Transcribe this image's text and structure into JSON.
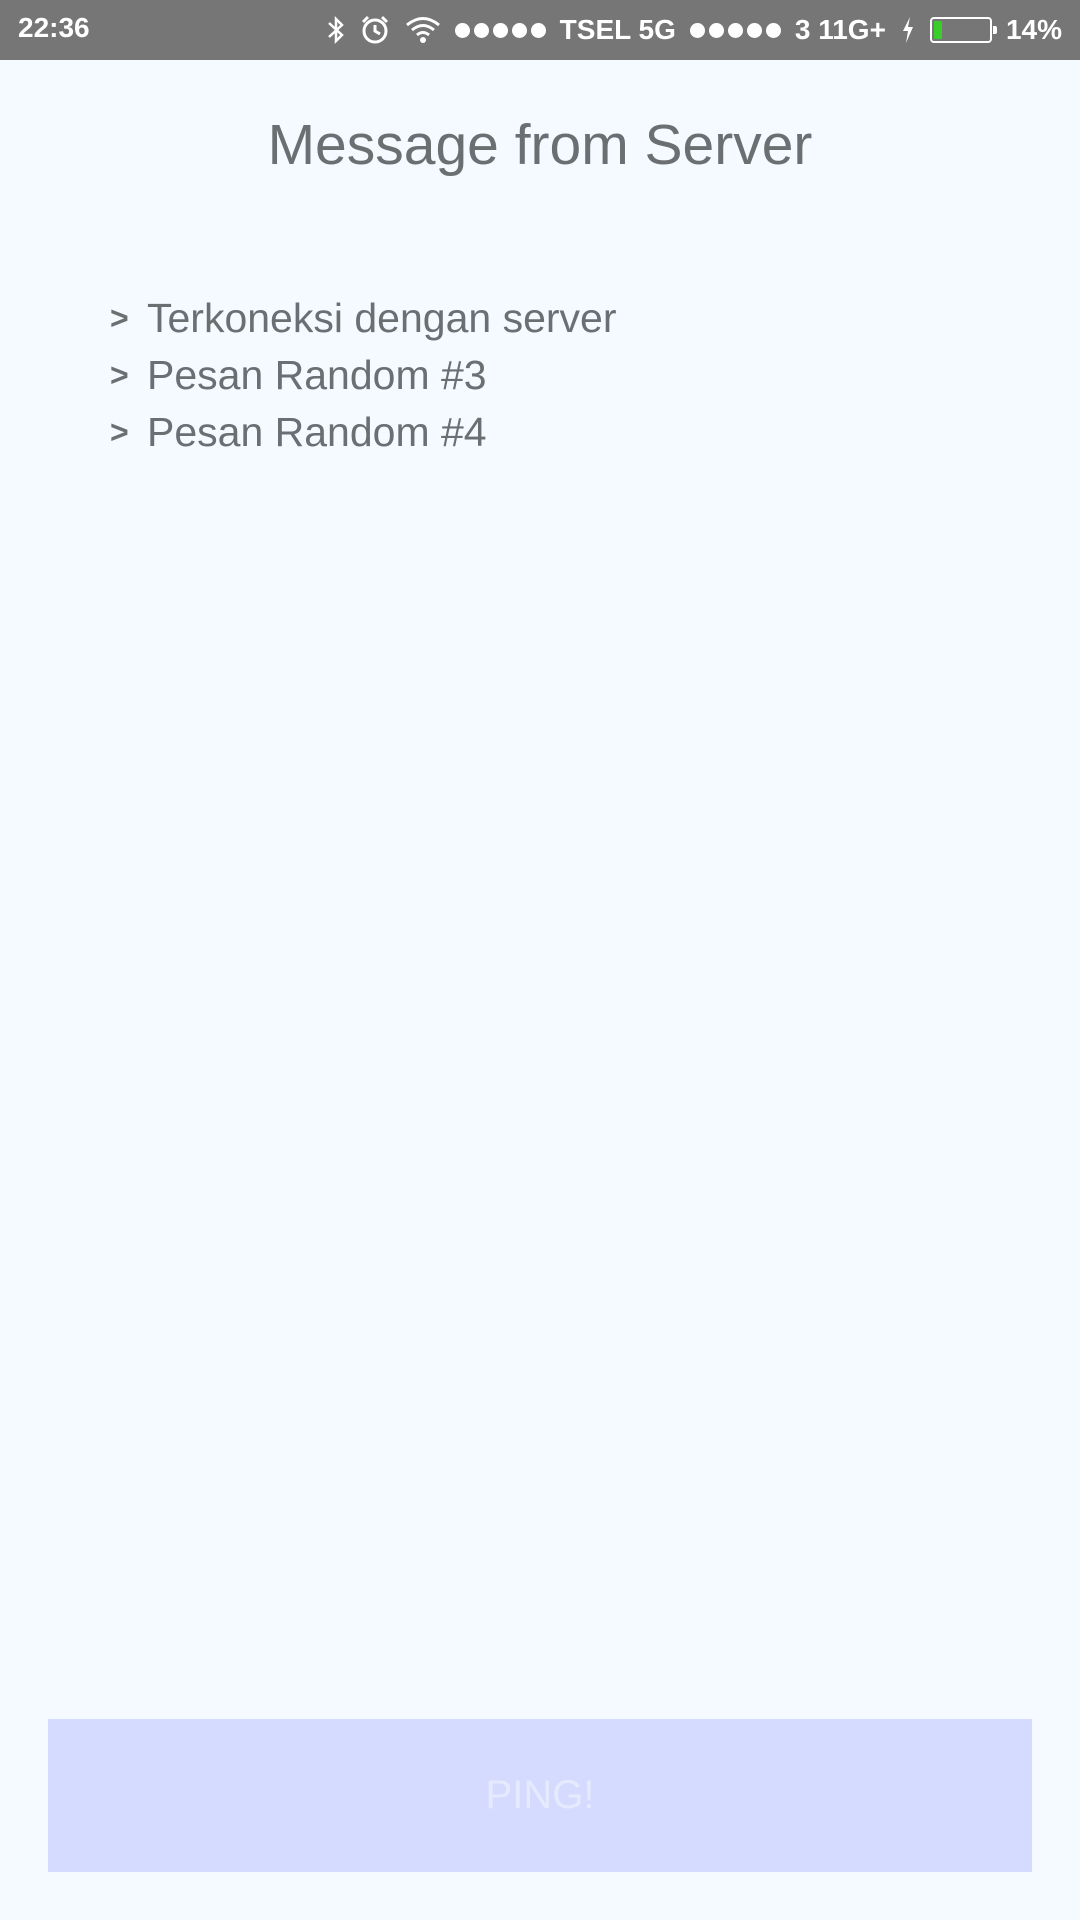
{
  "status_bar": {
    "time": "22:36",
    "carrier1": "TSEL 5G",
    "carrier2": "3 11G+",
    "battery": "14%",
    "battery_level": 0.14,
    "icons": [
      "bluetooth-icon",
      "alarm-icon",
      "wifi-icon",
      "signal-dots-icon",
      "charging-icon",
      "battery-icon"
    ],
    "battery_fill_color": "#3ACD2A"
  },
  "header": {
    "title": "Message from Server"
  },
  "messages": [
    {
      "prefix": ">",
      "text": "Terkoneksi dengan server"
    },
    {
      "prefix": ">",
      "text": "Pesan Random #3"
    },
    {
      "prefix": ">",
      "text": "Pesan Random #4"
    }
  ],
  "actions": {
    "ping_label": "PING!"
  },
  "colors": {
    "background": "#F4FAFF",
    "status_bar": "#767676",
    "text": "#6C6F72",
    "button_bg": "#D5DBFF"
  }
}
